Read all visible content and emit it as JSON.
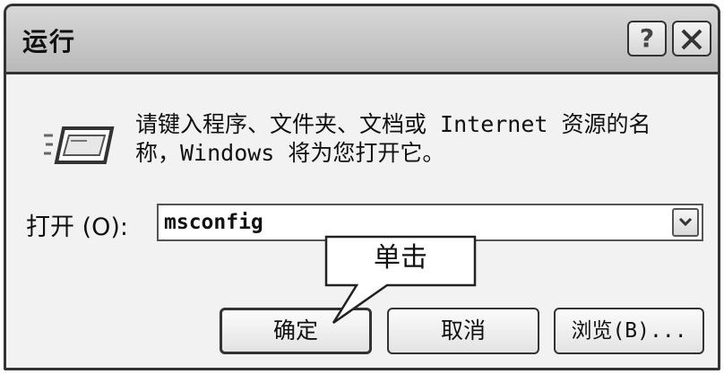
{
  "window": {
    "title": "运行"
  },
  "title_buttons": {
    "help_label": "?",
    "close_icon": "close-icon"
  },
  "dialog": {
    "description_line1": "请键入程序、文件夹、文档或 Internet 资源的名",
    "description_line2": "称，Windows 将为您打开它。",
    "open_label": "打开 (O):",
    "open_value": "msconfig"
  },
  "buttons": {
    "ok_label": "确定",
    "cancel_label": "取消",
    "browse_label": "浏览(B)..."
  },
  "annotation": {
    "callout_text": "单击"
  },
  "icons": {
    "run": "run-icon",
    "help": "help-icon",
    "close": "close-icon",
    "dropdown": "chevron-down-icon"
  },
  "colors": {
    "frame": "#333333",
    "background": "#f2f2f2",
    "titlebar": "#c8c8c8",
    "input_background": "#ffffff"
  }
}
